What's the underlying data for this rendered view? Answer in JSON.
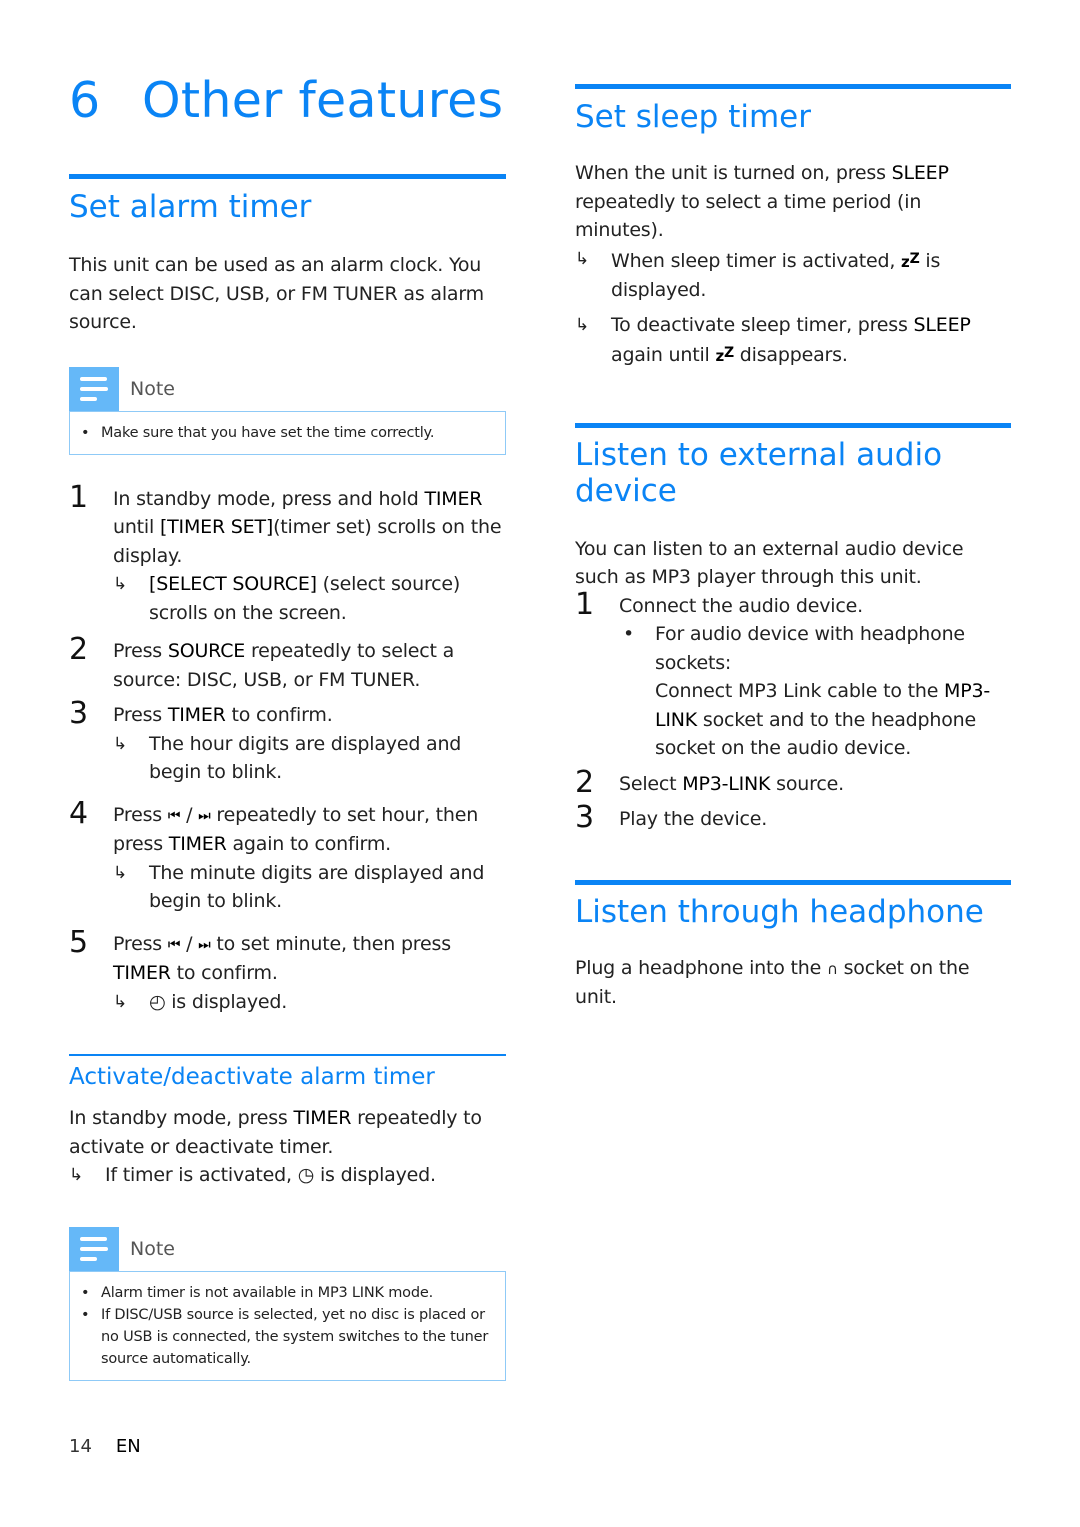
{
  "chapter": {
    "number": "6",
    "title": "Other features"
  },
  "alarm": {
    "heading": "Set alarm timer",
    "intro": "This unit can be used as an alarm clock. You can select DISC, USB, or FM TUNER as alarm source.",
    "note_label": "Note",
    "note_items": [
      "Make sure that you have set the time correctly."
    ],
    "steps": [
      {
        "num": "1",
        "pre": "In standby mode, press and hold ",
        "key": "TIMER",
        "mid": " until ",
        "key2": "[TIMER SET]",
        "post": "(timer set) scrolls on the display.",
        "result_key": "[SELECT SOURCE]",
        "result": " (select source) scrolls on the screen."
      },
      {
        "num": "2",
        "pre": "Press ",
        "key": "SOURCE",
        "post": "  repeatedly to select a source: DISC, USB, or FM TUNER."
      },
      {
        "num": "3",
        "pre": "Press ",
        "key": "TIMER",
        "post": " to confirm.",
        "result": "The hour digits are displayed and begin to blink."
      },
      {
        "num": "4",
        "pre": "Press ",
        "mid": " repeatedly to set hour, then press ",
        "key": "TIMER",
        "post": " again to confirm.",
        "result": "The minute digits are displayed and begin to blink."
      },
      {
        "num": "5",
        "pre": "Press ",
        "mid": " to set minute, then press ",
        "key": "TIMER",
        "post": " to confirm.",
        "result": " is displayed."
      }
    ],
    "prev_glyph": "⏮",
    "next_glyph": "⏭",
    "slash": " / ",
    "clock_glyph": "◴",
    "arrow_glyph": "↳"
  },
  "activate": {
    "heading": "Activate/deactivate alarm timer",
    "pre": "In standby mode, press ",
    "key": "TIMER",
    "post": " repeatedly to activate or deactivate timer.",
    "result_pre": "If timer is activated, ",
    "result_icon": "◷",
    "result_post": " is displayed.",
    "note_label": "Note",
    "note_items": [
      "Alarm timer is not available in MP3 LINK mode.",
      "If DISC/USB source is selected, yet no disc is placed or no USB is connected, the system switches to the tuner source automatically."
    ]
  },
  "sleep": {
    "heading": "Set sleep timer",
    "pre": "When the unit is turned on, press ",
    "key": "SLEEP",
    "post": " repeatedly to select a time period (in minutes).",
    "result1_pre": "When sleep timer is activated, ",
    "result1_post": " is displayed.",
    "result2_pre": "To deactivate sleep timer, press ",
    "result2_key": "SLEEP",
    "result2_mid": " again until ",
    "result2_post": " disappears.",
    "zz_small": "z",
    "zz_big": "Z"
  },
  "external": {
    "heading": "Listen to external audio device",
    "intro": "You can listen to an external audio device such as MP3 player through this unit.",
    "step1_num": "1",
    "step1": "Connect the audio device.",
    "bullet": "For audio device with headphone sockets:",
    "bullet_cont_pre": "Connect MP3 Link cable to the ",
    "bullet_cont_key": "MP3-LINK",
    "bullet_cont_post": " socket and to the headphone socket on the audio device.",
    "step2_num": "2",
    "step2_pre": "Select ",
    "step2_key": "MP3-LINK",
    "step2_post": " source.",
    "step3_num": "3",
    "step3": "Play the device."
  },
  "headphone": {
    "heading": "Listen through headphone",
    "pre": "Plug a headphone into the ",
    "icon": "🎧",
    "post": " socket on the unit."
  },
  "footer": {
    "page": "14",
    "lang": "EN"
  }
}
